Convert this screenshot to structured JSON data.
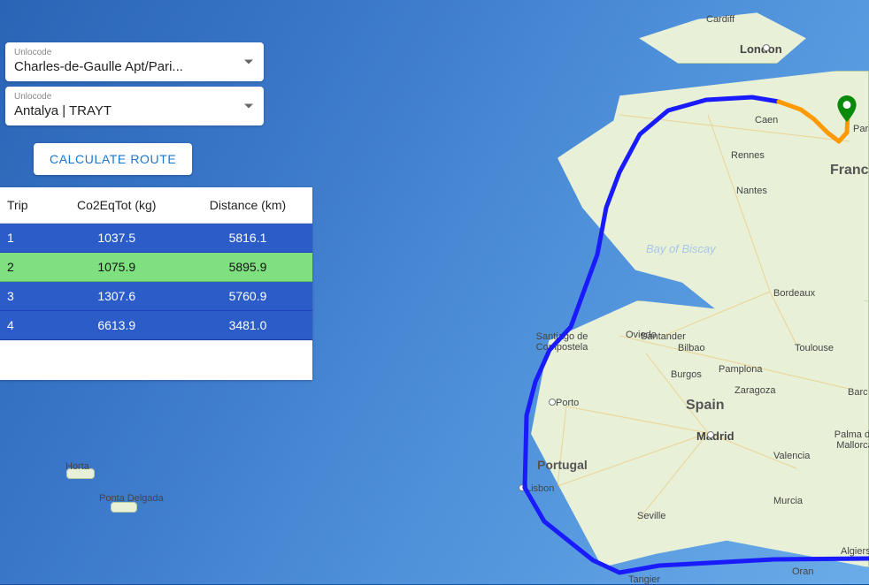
{
  "origin": {
    "label": "Unlocode",
    "value": "Charles-de-Gaulle Apt/Pari..."
  },
  "destination": {
    "label": "Unlocode",
    "value": "Antalya | TRAYT"
  },
  "actions": {
    "calculate": "CALCULATE ROUTE"
  },
  "results": {
    "headers": {
      "trip": "Trip",
      "co2": "Co2EqTot (kg)",
      "distance": "Distance (km)"
    },
    "rows": [
      {
        "trip": "1",
        "co2": "1037.5",
        "distance": "5816.1",
        "selected": false
      },
      {
        "trip": "2",
        "co2": "1075.9",
        "distance": "5895.9",
        "selected": true
      },
      {
        "trip": "3",
        "co2": "1307.6",
        "distance": "5760.9",
        "selected": false
      },
      {
        "trip": "4",
        "co2": "6613.9",
        "distance": "3481.0",
        "selected": false
      }
    ]
  },
  "map": {
    "sea_label": "Bay of\nBiscay",
    "countries": {
      "spain": "Spain",
      "france": "France",
      "portugal": "Portugal"
    },
    "cities": {
      "cardiff": "Cardiff",
      "london": "London",
      "caen": "Caen",
      "paris": "Pari",
      "rennes": "Rennes",
      "nantes": "Nantes",
      "bordeaux": "Bordeaux",
      "toulouse": "Toulouse",
      "barcelona": "Barc",
      "zaragoza": "Zaragoza",
      "pamplona": "Pamplona",
      "bilbao": "Bilbao",
      "burgos": "Burgos",
      "santander": "Santander",
      "oviedo": "Oviedo",
      "santiago": "Santiago de\nCompostela",
      "porto": "Porto",
      "lisbon": "Lisbon",
      "madrid": "Madrid",
      "valencia": "Valencia",
      "palma": "Palma de\nMallorca",
      "murcia": "Murcia",
      "seville": "Seville",
      "tangier": "Tangier",
      "oran": "Oran",
      "algiers": "Algiers",
      "horta": "Horta",
      "ponta": "Ponta Delgada"
    }
  }
}
